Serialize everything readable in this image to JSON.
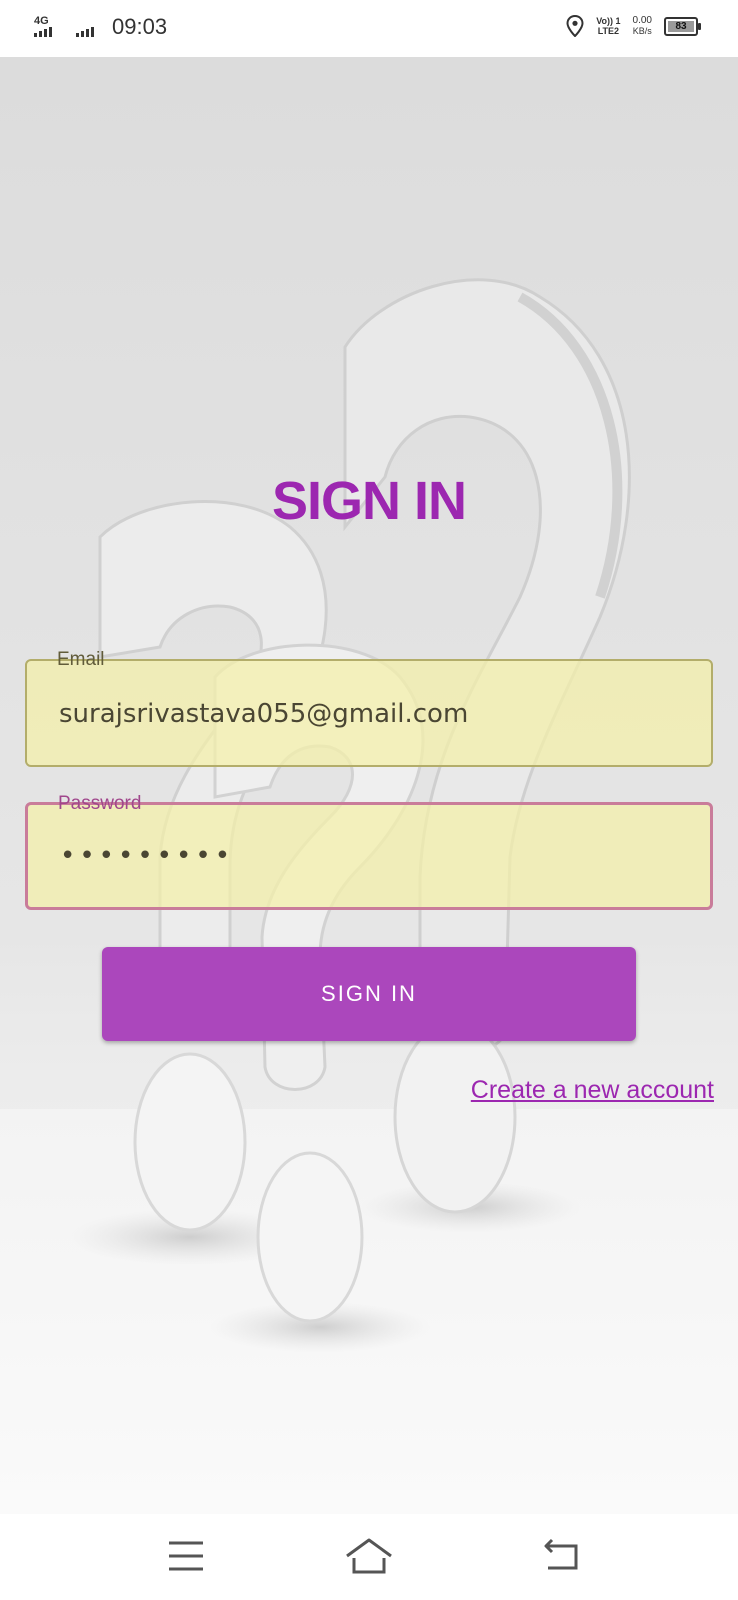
{
  "status": {
    "network": "4G",
    "time": "09:03",
    "volte_top": "Vo)) 1",
    "volte_bottom": "LTE2",
    "speed_value": "0.00",
    "speed_unit": "KB/s",
    "battery": "83"
  },
  "page": {
    "title": "SIGN IN"
  },
  "form": {
    "email_label": "Email",
    "email_value": "surajsrivastava055@gmail.com",
    "password_label": "Password",
    "password_value": "•••••••••",
    "submit_label": "SIGN IN",
    "create_account_link": "Create a new account"
  },
  "colors": {
    "accent": "#9c27b0",
    "button": "#ab47bc",
    "field_fill": "#f4f0a8",
    "password_border": "#c97c9a"
  },
  "nav": {
    "icons": [
      "menu-icon",
      "home-icon",
      "back-icon"
    ]
  }
}
